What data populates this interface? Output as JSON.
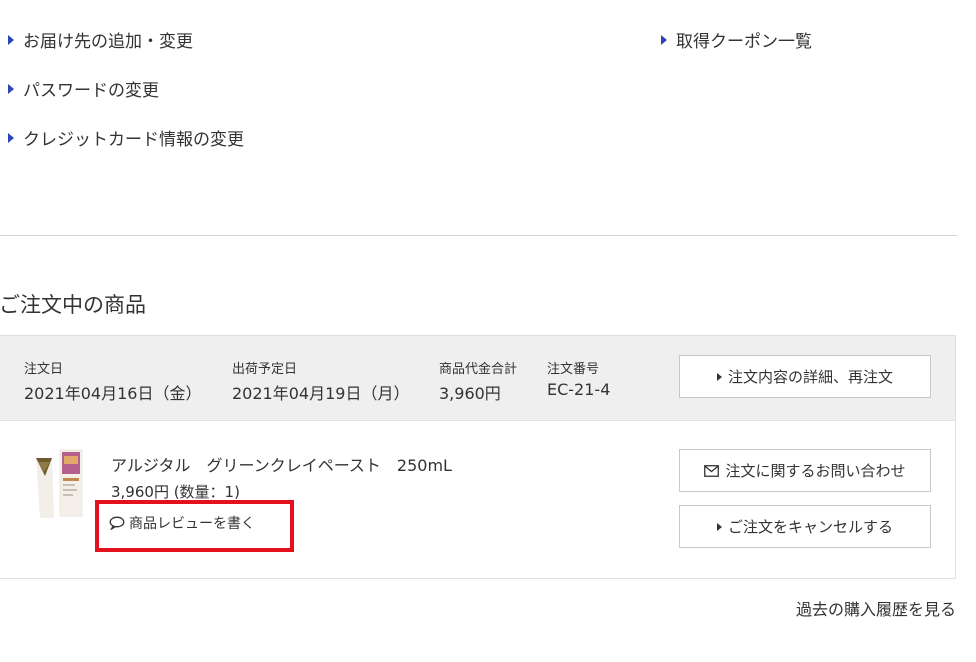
{
  "account_menu": {
    "links": [
      {
        "label": "お届け先の追加・変更"
      },
      {
        "label": "パスワードの変更"
      },
      {
        "label": "クレジットカード情報の変更"
      },
      {
        "label": "取得クーポン一覧"
      }
    ]
  },
  "orders_section": {
    "title": "ご注文中の商品"
  },
  "order": {
    "order_date_label": "注文日",
    "order_date": "2021年04月16日（金）",
    "ship_date_label": "出荷予定日",
    "ship_date": "2021年04月19日（月）",
    "total_label": "商品代金合計",
    "total": "3,960円",
    "order_number_label": "注文番号",
    "order_number": "EC-21-4",
    "detail_button": "注文内容の詳細、再注文",
    "inquiry_button": "注文に関するお問い合わせ",
    "cancel_button": "ご注文をキャンセルする",
    "item": {
      "name": "アルジタル　グリーンクレイペースト　250mL",
      "price_qty": "3,960円 (数量：1)",
      "review_link": "商品レビューを書く"
    }
  },
  "history_link": "過去の購入履歴を見る",
  "colors": {
    "accent_triangle": "#2b45b8",
    "highlight_red": "#e3101e",
    "header_bg": "#efefef"
  },
  "icons": {
    "menu_bullet": "triangle-right-icon",
    "inquiry": "envelope-icon",
    "review": "speech-bubble-icon"
  }
}
